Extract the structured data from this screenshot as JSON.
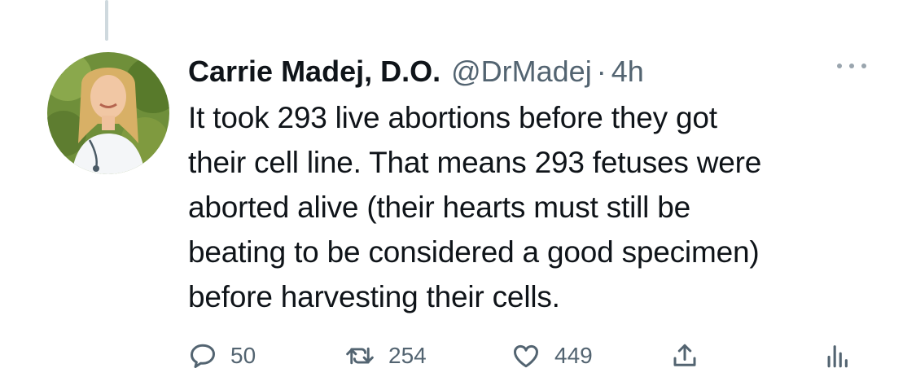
{
  "tweet": {
    "author": {
      "display_name": "Carrie Madej, D.O.",
      "handle": "@DrMadej",
      "separator": "·",
      "time": "4h"
    },
    "body_lines": [
      "It took 293 live abortions before they got",
      "their cell line. That means 293 fetuses were",
      "aborted alive (their hearts must still be",
      "beating to be considered a good specimen)",
      "before harvesting their cells."
    ],
    "actions": {
      "reply": {
        "icon": "reply-icon",
        "count": "50"
      },
      "retweet": {
        "icon": "retweet-icon",
        "count": "254"
      },
      "like": {
        "icon": "like-icon",
        "count": "449"
      },
      "share": {
        "icon": "share-icon"
      },
      "analytics": {
        "icon": "analytics-icon"
      }
    }
  },
  "colors": {
    "text": "#0f1419",
    "secondary_text": "#536471",
    "thread_line": "#cfd9de"
  }
}
